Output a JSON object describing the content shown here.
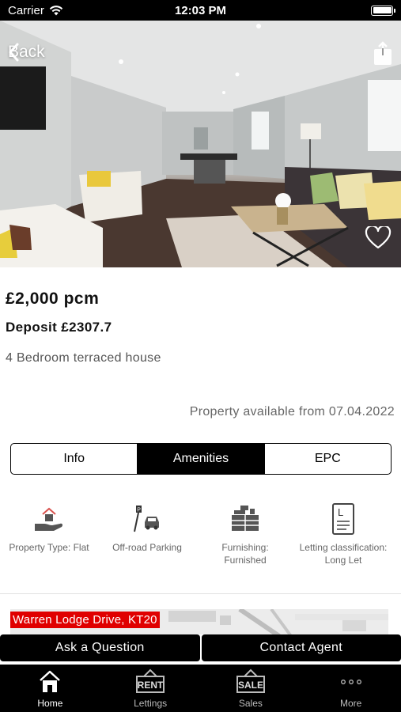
{
  "status_bar": {
    "carrier": "Carrier",
    "time": "12:03 PM"
  },
  "header": {
    "back_label": "Back"
  },
  "property": {
    "price": "£2,000 pcm",
    "deposit": "Deposit £2307.7",
    "description": "4 Bedroom terraced house",
    "available": "Property available from 07.04.2022"
  },
  "tabs": [
    {
      "label": "Info",
      "active": false
    },
    {
      "label": "Amenities",
      "active": true
    },
    {
      "label": "EPC",
      "active": false
    }
  ],
  "amenities": [
    {
      "icon": "house-in-hand-icon",
      "label": "Property Type: Flat"
    },
    {
      "icon": "parking-car-icon",
      "label": "Off-road Parking"
    },
    {
      "icon": "furniture-icon",
      "label": "Furnishing: Furnished"
    },
    {
      "icon": "letting-document-icon",
      "label": "Letting classification: Long Let"
    }
  ],
  "map": {
    "address": "Warren Lodge Drive, KT20"
  },
  "actions": {
    "ask": "Ask a Question",
    "contact": "Contact Agent"
  },
  "bottom_nav": [
    {
      "label": "Home",
      "icon": "home-icon",
      "active": true
    },
    {
      "label": "Lettings",
      "icon": "rent-sign-icon",
      "icon_text": "RENT",
      "active": false
    },
    {
      "label": "Sales",
      "icon": "sale-sign-icon",
      "icon_text": "SALE",
      "active": false
    },
    {
      "label": "More",
      "icon": "more-dots-icon",
      "active": false
    }
  ],
  "colors": {
    "accent": "#e00000",
    "bar": "#000000",
    "muted_text": "#666666"
  }
}
